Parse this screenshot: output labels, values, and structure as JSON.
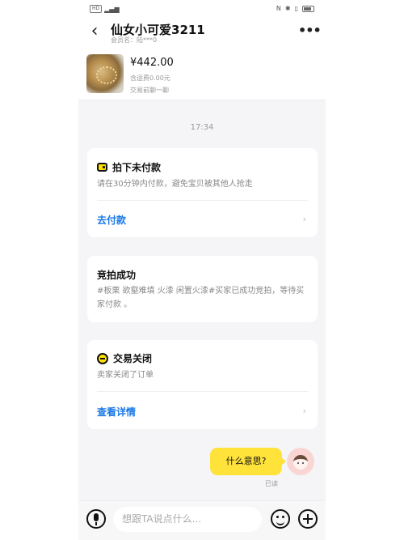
{
  "status_bar": {
    "left_icons": [
      "sim-icon",
      "signal-icon"
    ],
    "right_icons": [
      "nfc-icon",
      "bluetooth-icon",
      "vibrate-icon"
    ]
  },
  "header": {
    "title": "仙女小可爱3211",
    "member_name": "会员名：陆***0",
    "back_icon": "back-chevron-icon",
    "more_icon": "more-dots-icon"
  },
  "product": {
    "price": "¥442.00",
    "shipping": "含运费0.00元",
    "before_trade": "交易前聊一聊"
  },
  "timestamp": "17:34",
  "cards": {
    "unpaid": {
      "title": "拍下未付款",
      "desc": "请在30分钟内付款，避免宝贝被其他人抢走",
      "action": "去付款",
      "icon": "wallet-icon"
    },
    "auction": {
      "title": "竞拍成功",
      "desc": "#板栗 欲壑难填 火漆 闲置火漆#买家已成功竞拍，等待买家付款 。"
    },
    "closed": {
      "title": "交易关闭",
      "desc": "卖家关闭了订单",
      "action": "查看详情",
      "icon": "minus-circle-icon"
    }
  },
  "message": {
    "text": "什么意思?",
    "status": "已读"
  },
  "input_bar": {
    "placeholder": "想跟TA说点什么..."
  },
  "colors": {
    "accent_yellow": "#ffe33b",
    "link_blue": "#1a78e8"
  }
}
